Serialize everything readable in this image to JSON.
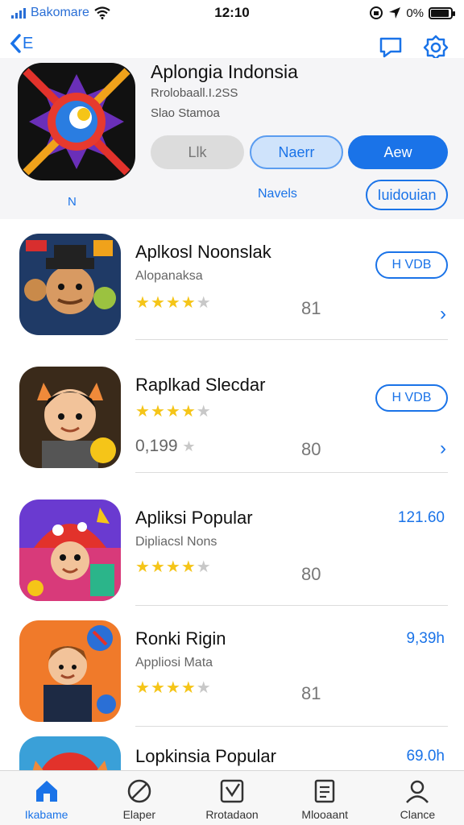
{
  "status": {
    "carrier": "Bakomare",
    "time": "12:10",
    "battery_text": "0%"
  },
  "nav": {
    "back_label": "E"
  },
  "hero": {
    "title": "Aplongia Indonsia",
    "subtitle": "Rrolobaall.I.2SS",
    "subtitle2": "Slao Stamoa",
    "pill_gray": "Llk",
    "pill_light": "Naerr",
    "pill_blue": "Aew",
    "left_label": "N",
    "link": "Navels",
    "outline_button": "Iuidouian"
  },
  "list": [
    {
      "title": "Aplkosl Noonslak",
      "subtitle": "Alopanaksa",
      "stars": 4,
      "rating": "81",
      "action": "H VDB",
      "icon": "app-icon-villain"
    },
    {
      "title": "Raplkad Slecdar",
      "subtitle": "",
      "count": "0,199",
      "stars": 4,
      "rating": "80",
      "action": "H VDB",
      "icon": "app-icon-boy"
    },
    {
      "title": "Apliksi Popular",
      "subtitle": "Dipliacsl Nons",
      "stars": 4,
      "rating": "80",
      "size": "121.60",
      "icon": "app-icon-mushroom"
    },
    {
      "title": "Ronki Rigin",
      "subtitle": "Appliosi Mata",
      "stars": 4,
      "rating": "81",
      "size": "9,39h",
      "icon": "app-icon-kid"
    },
    {
      "title": "Lopkinsia Popular",
      "subtitle": "",
      "size": "69.0h",
      "icon": "app-icon-fox"
    }
  ],
  "tabs": [
    {
      "label": "Ikabame",
      "icon": "home-icon",
      "active": true
    },
    {
      "label": "Elaper",
      "icon": "compass-icon",
      "active": false
    },
    {
      "label": "Rrotadaon",
      "icon": "download-icon",
      "active": false
    },
    {
      "label": "Mlooaant",
      "icon": "document-icon",
      "active": false
    },
    {
      "label": "Clance",
      "icon": "person-icon",
      "active": false
    }
  ],
  "colors": {
    "accent": "#1a73e8",
    "star": "#f5c518"
  }
}
